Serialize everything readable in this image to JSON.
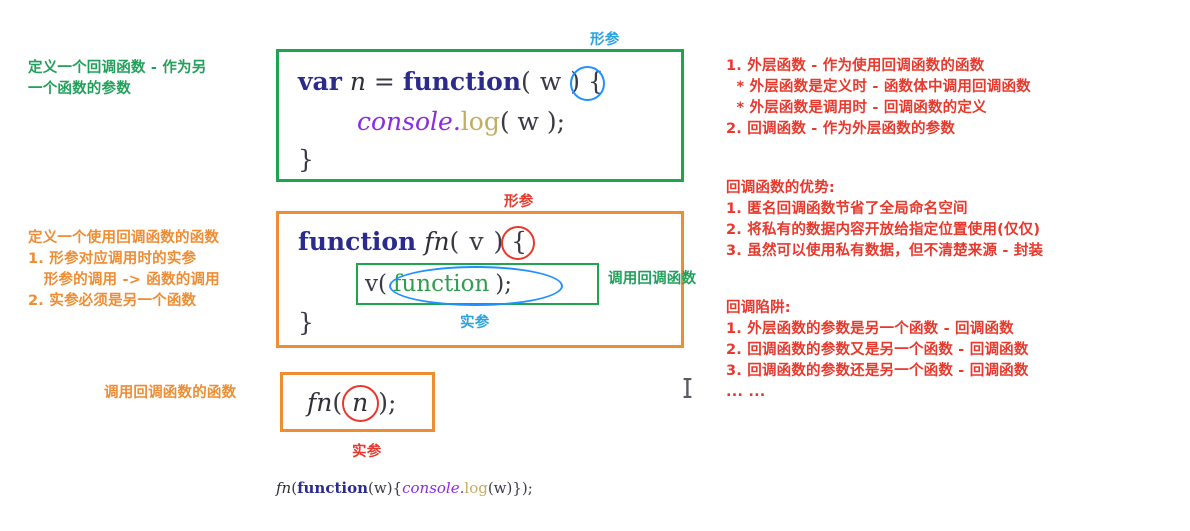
{
  "colors": {
    "green": "#21a05a",
    "orange": "#ef8d33",
    "red": "#e8392c",
    "light_blue": "#2aa3e0",
    "keyword_blue": "#2b2b8f",
    "object_purple": "#8a2be2",
    "method_tan": "#c3ad63",
    "circle_blue": "#1e90ff",
    "circle_red": "#e8392c",
    "box_green": "#1ea64f"
  },
  "left_notes": {
    "callback_definition": "定义一个回调函数 - 作为另\n一个函数的参数",
    "using_function": "定义一个使用回调函数的函数\n1. 形参对应调用时的实参\n   形参的调用 -> 函数的调用\n2. 实参必须是另一个函数",
    "invoke_function": "调用回调函数的函数"
  },
  "boxes": {
    "box1": {
      "label_top": "形参",
      "code_line1_kw1": "var",
      "code_line1_ident": "n",
      "code_line1_eq": " = ",
      "code_line1_kw2": "function",
      "code_line1_paren_open": "(",
      "code_line1_param": "w",
      "code_line1_tail": ") {",
      "code_line2_obj": "console",
      "code_line2_dot": ".",
      "code_line2_meth": "log",
      "code_line2_args": "( w );",
      "code_line3": "}"
    },
    "box2": {
      "label_top": "形参",
      "label_right": "调用回调函数",
      "label_bottom": "实参",
      "code_line1_kw": "function",
      "code_line1_ident": "fn",
      "code_line1_paren_open": "(",
      "code_line1_param": "v",
      "code_line1_tail": ") {",
      "code_line2_callee": "v",
      "code_line2_paren_open": "(",
      "code_line2_arg": "function",
      "code_line2_tail": ");",
      "code_line3": "}"
    },
    "box3": {
      "label_bottom": "实参",
      "code_ident": "fn",
      "code_paren_open": "(",
      "code_arg": "n",
      "code_tail": ");"
    }
  },
  "bottom_code": {
    "part1_ident": "fn",
    "part2_paren": "(",
    "part3_kw": "function",
    "part4_params": "(w){",
    "part5_obj": "console",
    "part6_dot": ".",
    "part7_meth": "log",
    "part8_tail": "(w)});"
  },
  "right_notes": {
    "block1": "1. 外层函数 - 作为使用回调函数的函数\n  * 外层函数是定义时 - 函数体中调用回调函数\n  * 外层函数是调用时 - 回调函数的定义\n2. 回调函数 - 作为外层函数的参数",
    "block2_title": "回调函数的优势:",
    "block2_body": "1. 匿名回调函数节省了全局命名空间\n2. 将私有的数据内容开放给指定位置使用(仅仅)\n3. 虽然可以使用私有数据，但不清楚来源 - 封装",
    "block3_title": "回调陷阱:",
    "block3_body": "1. 外层函数的参数是另一个函数 - 回调函数\n2. 回调函数的参数又是另一个函数 - 回调函数\n3. 回调函数的参数还是另一个函数 - 回调函数\n... ..."
  },
  "cursor": {
    "name": "text-ibeam-cursor"
  }
}
